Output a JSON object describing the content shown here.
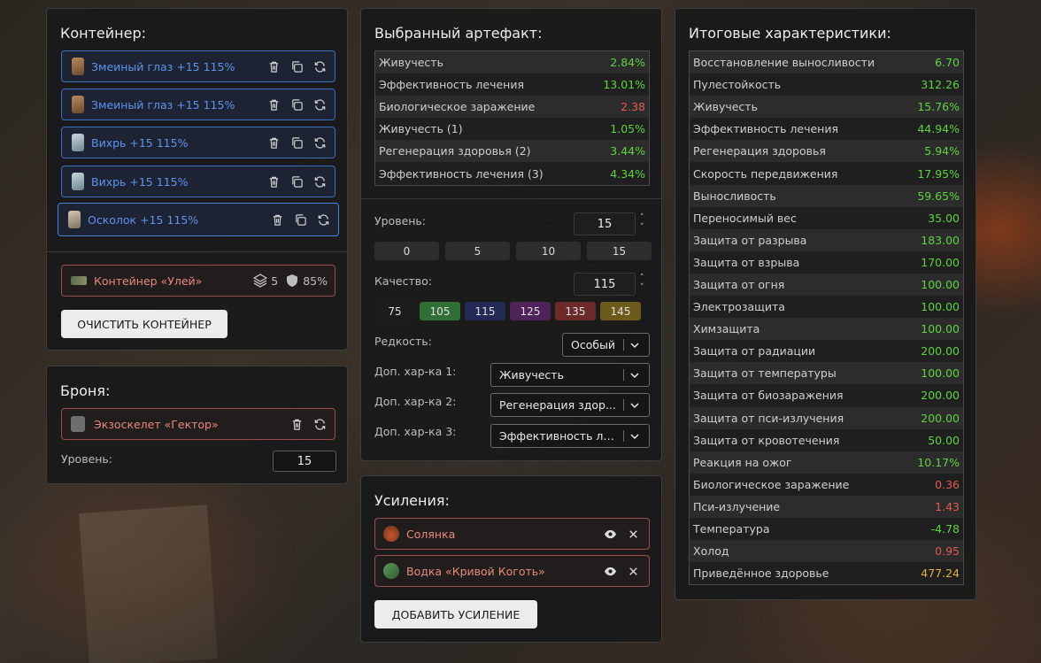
{
  "container": {
    "title": "Контейнер:",
    "slots": [
      {
        "label": "Змеиный глаз +15 115%",
        "icon": "snake-eye-icon"
      },
      {
        "label": "Змеиный глаз +15 115%",
        "icon": "snake-eye-icon"
      },
      {
        "label": "Вихрь +15 115%",
        "icon": "whirlwind-icon"
      },
      {
        "label": "Вихрь +15 115%",
        "icon": "whirlwind-icon"
      },
      {
        "label": "Осколок +15 115%",
        "icon": "shard-icon"
      }
    ],
    "hive": {
      "label": "Контейнер «Улей»",
      "slots": "5",
      "protection": "85%"
    },
    "clear_button": "ОЧИСТИТЬ КОНТЕЙНЕР"
  },
  "armor": {
    "title": "Броня:",
    "item": "Экзоскелет «Гектор»",
    "level_label": "Уровень:",
    "level_value": "15"
  },
  "artifact": {
    "title": "Выбранный артефакт:",
    "stats": [
      {
        "label": "Живучесть",
        "value": "2.84%",
        "color": "green"
      },
      {
        "label": "Эффективность лечения",
        "value": "13.01%",
        "color": "green"
      },
      {
        "label": "Биологическое заражение",
        "value": "2.38",
        "color": "red"
      },
      {
        "label": "Живучесть (1)",
        "value": "1.05%",
        "color": "green"
      },
      {
        "label": "Регенерация здоровья (2)",
        "value": "3.44%",
        "color": "green"
      },
      {
        "label": "Эффективность лечения (3)",
        "value": "4.34%",
        "color": "green"
      }
    ],
    "level_label": "Уровень:",
    "level_value": "15",
    "level_presets": [
      "0",
      "5",
      "10",
      "15"
    ],
    "quality_label": "Качество:",
    "quality_value": "115",
    "quality_presets": [
      {
        "label": "75",
        "color": "#1c1c1c"
      },
      {
        "label": "105",
        "color": "#2f6e37"
      },
      {
        "label": "115",
        "color": "#232a55"
      },
      {
        "label": "125",
        "color": "#4d2359"
      },
      {
        "label": "135",
        "color": "#6a2a2a"
      },
      {
        "label": "145",
        "color": "#6b5a1a"
      }
    ],
    "rarity_label": "Редкость:",
    "rarity_value": "Особый",
    "extra1_label": "Доп. хар-ка 1:",
    "extra1_value": "Живучесть",
    "extra2_label": "Доп. хар-ка 2:",
    "extra2_value": "Регенерация здор...",
    "extra3_label": "Доп. хар-ка 3:",
    "extra3_value": "Эффективность ле..."
  },
  "boosts": {
    "title": "Усиления:",
    "items": [
      {
        "label": "Солянка",
        "icon": "solyanka-icon"
      },
      {
        "label": "Водка «Кривой Коготь»",
        "icon": "vodka-bottle-icon"
      }
    ],
    "add_button": "ДОБАВИТЬ УСИЛЕНИЕ"
  },
  "totals": {
    "title": "Итоговые характеристики:",
    "stats": [
      {
        "label": "Восстановление выносливости",
        "value": "6.70",
        "color": "green"
      },
      {
        "label": "Пулестойкость",
        "value": "312.26",
        "color": "green"
      },
      {
        "label": "Живучесть",
        "value": "15.76%",
        "color": "green"
      },
      {
        "label": "Эффективность лечения",
        "value": "44.94%",
        "color": "green"
      },
      {
        "label": "Регенерация здоровья",
        "value": "5.94%",
        "color": "green"
      },
      {
        "label": "Скорость передвижения",
        "value": "17.95%",
        "color": "green"
      },
      {
        "label": "Выносливость",
        "value": "59.65%",
        "color": "green"
      },
      {
        "label": "Переносимый вес",
        "value": "35.00",
        "color": "green"
      },
      {
        "label": "Защита от разрыва",
        "value": "183.00",
        "color": "green"
      },
      {
        "label": "Защита от взрыва",
        "value": "170.00",
        "color": "green"
      },
      {
        "label": "Защита от огня",
        "value": "100.00",
        "color": "green"
      },
      {
        "label": "Электрозащита",
        "value": "100.00",
        "color": "green"
      },
      {
        "label": "Химзащита",
        "value": "100.00",
        "color": "green"
      },
      {
        "label": "Защита от радиации",
        "value": "200.00",
        "color": "green"
      },
      {
        "label": "Защита от температуры",
        "value": "100.00",
        "color": "green"
      },
      {
        "label": "Защита от биозаражения",
        "value": "200.00",
        "color": "green"
      },
      {
        "label": "Защита от пси-излучения",
        "value": "200.00",
        "color": "green"
      },
      {
        "label": "Защита от кровотечения",
        "value": "50.00",
        "color": "green"
      },
      {
        "label": "Реакция на ожог",
        "value": "10.17%",
        "color": "green"
      },
      {
        "label": "Биологическое заражение",
        "value": "0.36",
        "color": "red"
      },
      {
        "label": "Пси-излучение",
        "value": "1.43",
        "color": "red"
      },
      {
        "label": "Температура",
        "value": "-4.78",
        "color": "green"
      },
      {
        "label": "Холод",
        "value": "0.95",
        "color": "red"
      },
      {
        "label": "Приведённое здоровье",
        "value": "477.24",
        "color": "yellow"
      }
    ]
  }
}
